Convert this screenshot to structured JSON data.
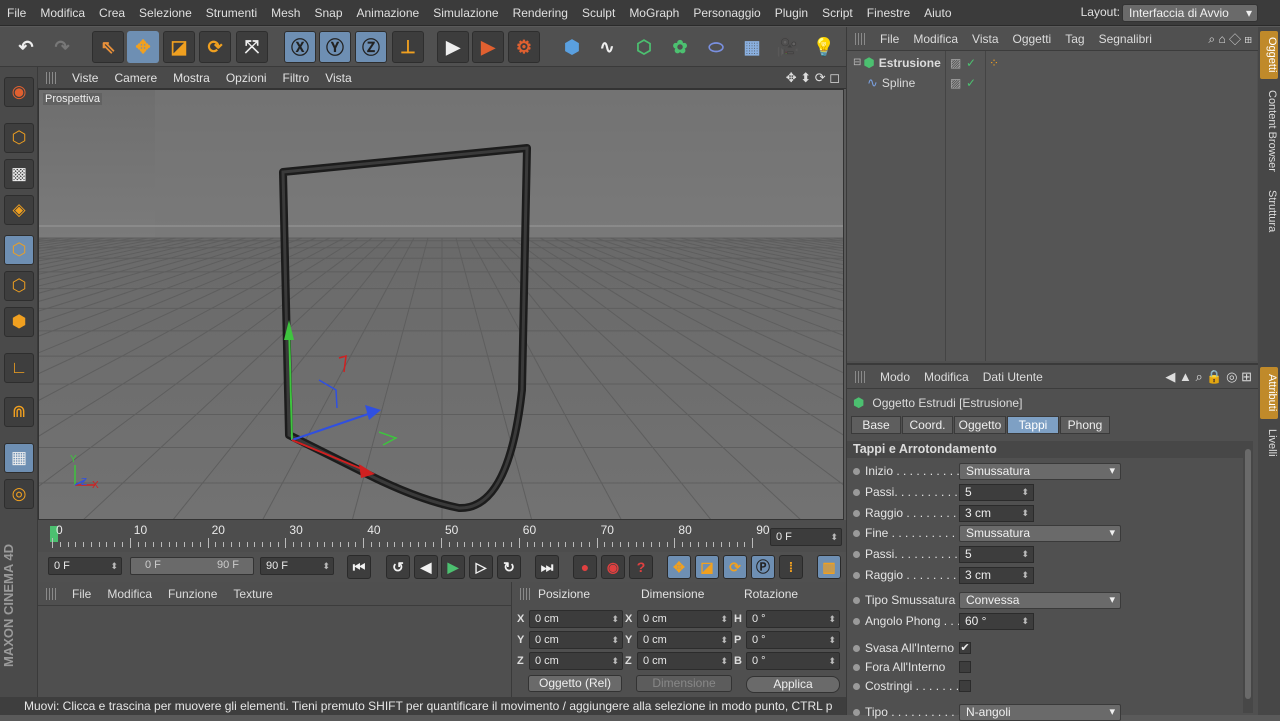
{
  "menubar": {
    "items": [
      "File",
      "Modifica",
      "Crea",
      "Selezione",
      "Strumenti",
      "Mesh",
      "Snap",
      "Animazione",
      "Simulazione",
      "Rendering",
      "Sculpt",
      "MoGraph",
      "Personaggio",
      "Plugin",
      "Script",
      "Finestre",
      "Aiuto"
    ],
    "layout_label": "Layout:",
    "layout_value": "Interfaccia di Avvio"
  },
  "viewport": {
    "menu": [
      "Viste",
      "Camere",
      "Mostra",
      "Opzioni",
      "Filtro",
      "Vista"
    ],
    "label": "Prospettiva",
    "axis_y": "Y",
    "axis_z": "Z",
    "axis_x": "X"
  },
  "timeline": {
    "ticks": [
      "0",
      "10",
      "20",
      "30",
      "40",
      "50",
      "60",
      "70",
      "80",
      "90"
    ],
    "current_frame": "0 F",
    "start_field": "0 F",
    "range_min": "0 F",
    "range_max": "90 F",
    "end_field": "90 F"
  },
  "materials": {
    "menu": [
      "File",
      "Modifica",
      "Funzione",
      "Texture"
    ]
  },
  "coords": {
    "headers": [
      "Posizione",
      "Dimensione",
      "Rotazione"
    ],
    "pos": [
      {
        "axis": "X",
        "value": "0 cm"
      },
      {
        "axis": "Y",
        "value": "0 cm"
      },
      {
        "axis": "Z",
        "value": "0 cm"
      }
    ],
    "dim": [
      {
        "axis": "X",
        "value": "0 cm"
      },
      {
        "axis": "Y",
        "value": "0 cm"
      },
      {
        "axis": "Z",
        "value": "0 cm"
      }
    ],
    "rot": [
      {
        "axis": "H",
        "value": "0 °"
      },
      {
        "axis": "P",
        "value": "0 °"
      },
      {
        "axis": "B",
        "value": "0 °"
      }
    ],
    "mode_select": "Oggetto (Rel)",
    "dim_select": "Dimensione",
    "apply": "Applica"
  },
  "status": {
    "text": "Muovi: Clicca e trascina per muovere gli elementi. Tieni premuto SHIFT per quantificare il movimento / aggiungere alla selezione in modo punto, CTRL p"
  },
  "objects": {
    "menu": [
      "File",
      "Modifica",
      "Vista",
      "Oggetti",
      "Tag",
      "Segnalibri"
    ],
    "tree": [
      {
        "name": "Estrusione",
        "color": "#f0a020"
      },
      {
        "name": "Spline",
        "color": "#f0a020"
      }
    ]
  },
  "attributes": {
    "menu": [
      "Modo",
      "Modifica",
      "Dati Utente"
    ],
    "object_title": "Oggetto Estrudi [Estrusione]",
    "tabs": [
      "Base",
      "Coord.",
      "Oggetto",
      "Tappi",
      "Phong"
    ],
    "active_tab": "Tappi",
    "section": "Tappi e Arrotondamento",
    "rows": [
      {
        "label": "Inizio . . . . . . . . . .",
        "type": "dropdown",
        "value": "Smussatura"
      },
      {
        "label": "Passi. . . . . . . . . . .",
        "type": "number",
        "value": "5"
      },
      {
        "label": "Raggio . . . . . . . . .",
        "type": "number",
        "value": "3 cm"
      },
      {
        "label": "Fine . . . . . . . . . . .",
        "type": "dropdown",
        "value": "Smussatura"
      },
      {
        "label": "Passi. . . . . . . . . . .",
        "type": "number",
        "value": "5"
      },
      {
        "label": "Raggio . . . . . . . . .",
        "type": "number",
        "value": "3 cm"
      },
      {
        "label": "Tipo Smussatura",
        "type": "dropdown",
        "value": "Convessa"
      },
      {
        "label": "Angolo Phong . . .",
        "type": "number",
        "value": "60 °"
      },
      {
        "label": "Svasa All'Interno",
        "type": "checkbox",
        "value": "✔"
      },
      {
        "label": "Fora All'Interno",
        "type": "checkbox",
        "value": ""
      },
      {
        "label": "Costringi . . . . . . .",
        "type": "checkbox",
        "value": ""
      },
      {
        "label": "Tipo . . . . . . . . . . .",
        "type": "dropdown",
        "value": "N-angoli"
      }
    ]
  },
  "sidetabs": {
    "top": [
      "Oggetti",
      "Content Browser",
      "Struttura"
    ],
    "bottom": [
      "Attributi",
      "Livelli"
    ]
  },
  "brand": "MAXON CINEMA 4D"
}
